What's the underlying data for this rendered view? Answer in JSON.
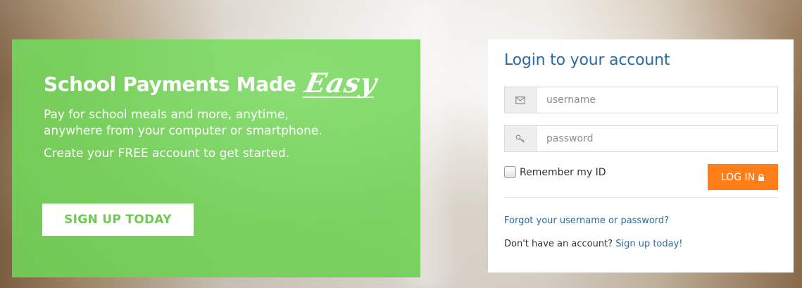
{
  "hero": {
    "title_prefix": "School Payments Made",
    "title_accent": "Easy",
    "line1": "Pay for school meals and more, anytime,",
    "line2": "anywhere from your computer or smartphone.",
    "line3": "Create your FREE account to get started.",
    "signup_button": "SIGN UP TODAY",
    "background_color": "#76d65c",
    "button_text_color": "#71c857"
  },
  "login": {
    "title": "Login to your account",
    "username_placeholder": "username",
    "password_placeholder": "password",
    "username_icon": "envelope-icon",
    "password_icon": "key-icon",
    "remember_label": "Remember my ID",
    "login_button": "LOG IN",
    "login_button_icon": "lock-icon",
    "forgot_link": "Forgot your username or password?",
    "no_account_text": "Don't have an account?",
    "signup_link": "Sign up today!",
    "accent_color": "#2c6aa4",
    "button_color": "#ff7e1a"
  }
}
